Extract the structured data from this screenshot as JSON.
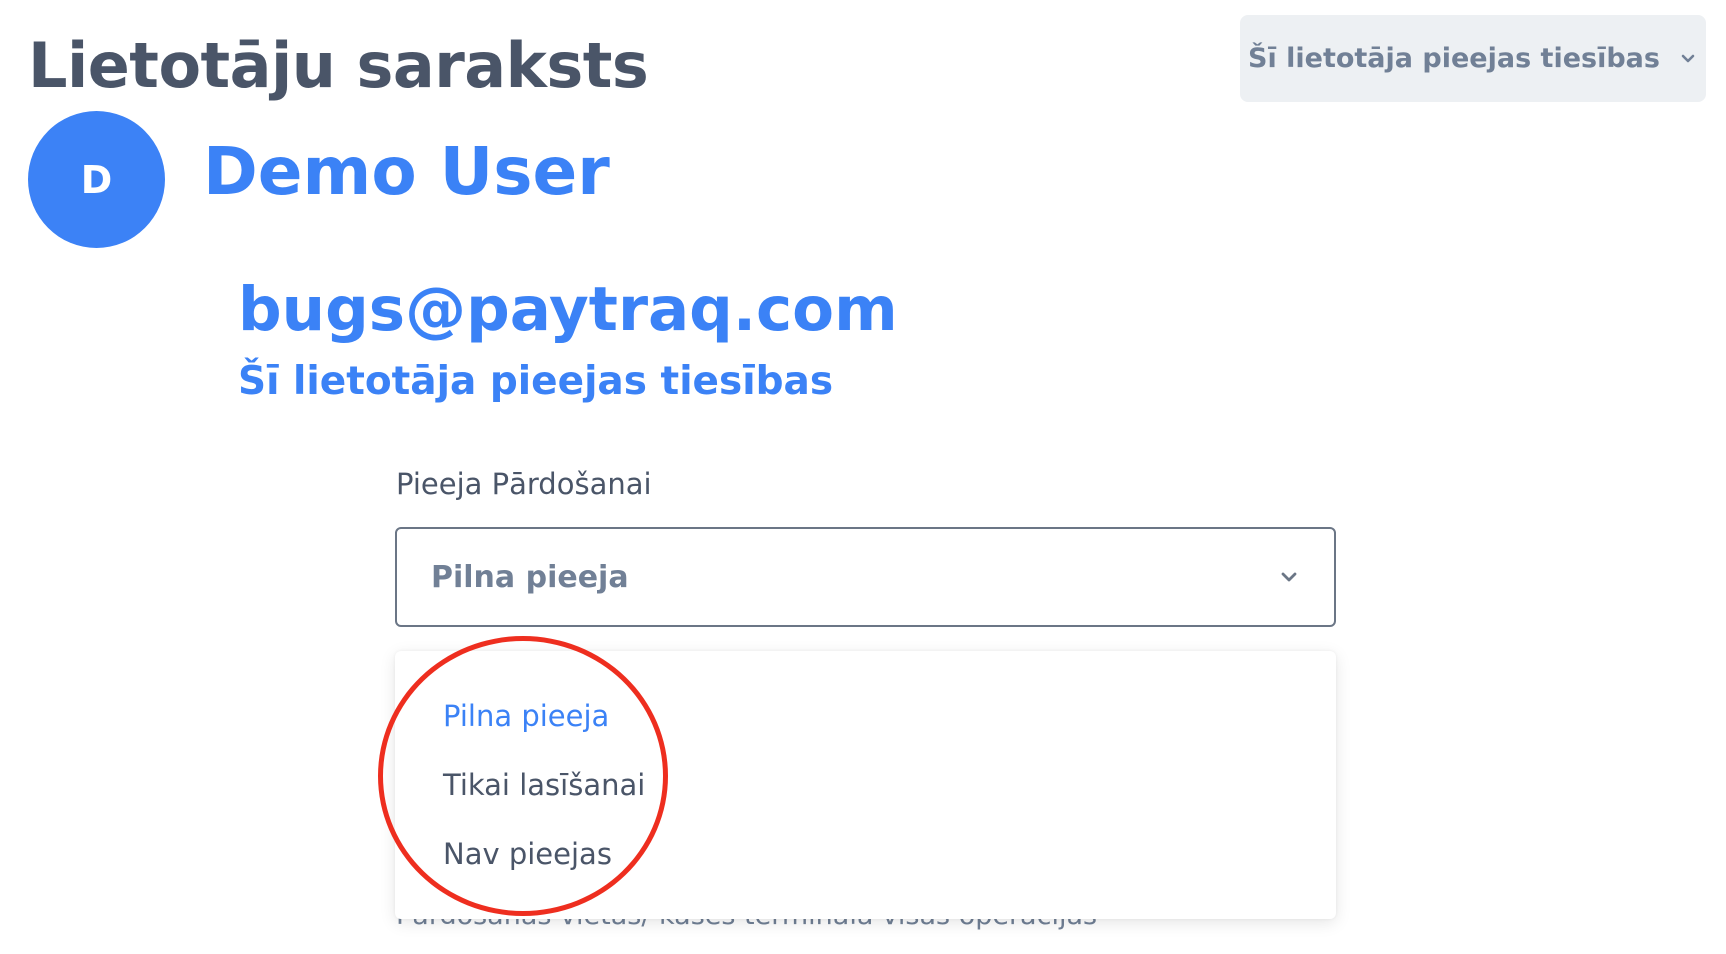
{
  "header": {
    "title": "Lietotāju saraksts",
    "permissions_button_label": "Šī lietotāja pieejas tiesības",
    "permissions_button_icon": "chevron-down-icon"
  },
  "user": {
    "avatar_initial": "D",
    "avatar_color": "#3c82f6",
    "name": "Demo User",
    "email": "bugs@paytraq.com",
    "permissions_link": "Šī lietotāja pieejas tiesības"
  },
  "sales_access": {
    "label": "Pieeja Pārdošanai",
    "selected_value": "Pilna pieeja",
    "select_icon": "chevron-down-icon",
    "options": [
      "Pilna pieeja",
      "Tikai lasīšanai",
      "Nav pieejas"
    ],
    "description_partial": "Pārdošanas vietas/ kases termināla visas operācijas"
  },
  "colors": {
    "accent": "#3b82f6",
    "title_text": "#4a5568",
    "muted_text": "#718096",
    "annotation": "#ee2e1f"
  }
}
